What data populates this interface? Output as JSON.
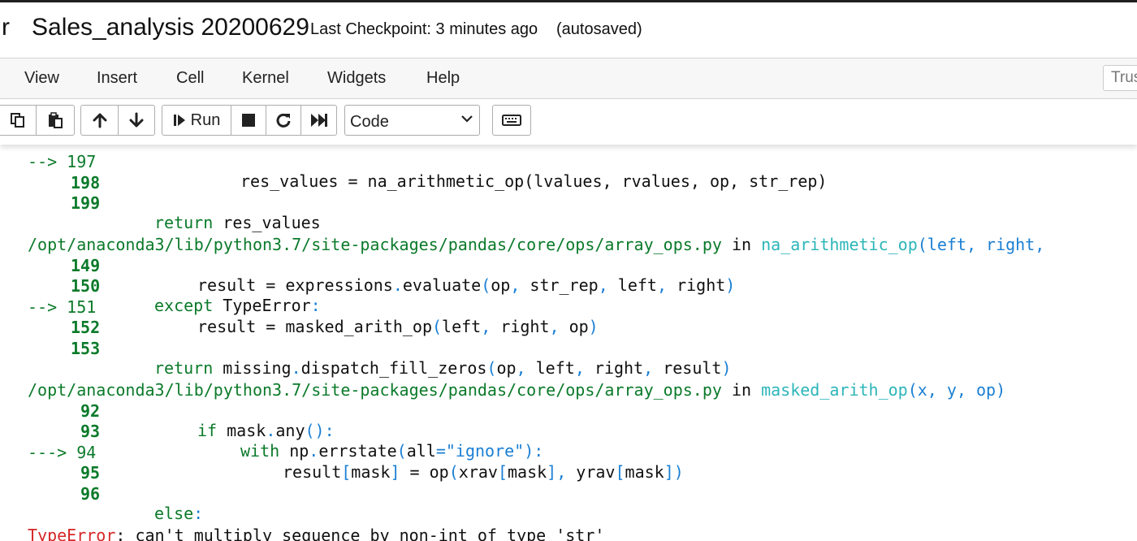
{
  "header": {
    "logo_fragment": "r",
    "notebook_title": "Sales_analysis 20200629",
    "checkpoint": "Last Checkpoint: 3 minutes ago",
    "autosaved": "(autosaved)"
  },
  "menu": {
    "items": [
      "View",
      "Insert",
      "Cell",
      "Kernel",
      "Widgets",
      "Help"
    ],
    "trusted": "Trus"
  },
  "toolbar": {
    "run_label": "Run",
    "cell_type": "Code"
  },
  "traceback": {
    "partial_line": {
      "arrow": "--> 197",
      "code": "res_values = na_arithmetic_op(lvalues, rvalues, op, str_rep)"
    },
    "frame1": [
      {
        "num": "198",
        "code": ""
      },
      {
        "num": "199",
        "kw": "return",
        "code": " res_values"
      }
    ],
    "frame2": {
      "file": "/opt/anaconda3/lib/python3.7/site-packages/pandas/core/ops/array_ops.py",
      "in": " in ",
      "func": "na_arithmetic_op",
      "args": "(left, right,",
      "lines": [
        {
          "num": "149",
          "text": "result = expressions.evaluate(op, str_rep, left, right)"
        },
        {
          "num": "150",
          "text": "except TypeError:"
        },
        {
          "num": "151",
          "arrow": "--> ",
          "text": "result = masked_arith_op(left, right, op)"
        },
        {
          "num": "152",
          "text": ""
        },
        {
          "num": "153",
          "text": "return missing.dispatch_fill_zeros(op, left, right, result)"
        }
      ]
    },
    "frame3": {
      "file": "/opt/anaconda3/lib/python3.7/site-packages/pandas/core/ops/array_ops.py",
      "in": " in ",
      "func": "masked_arith_op",
      "args": "(x, y, op)",
      "lines": [
        {
          "num": "92",
          "text": "if mask.any():"
        },
        {
          "num": "93",
          "text": "with np.errstate(all=\"ignore\"):"
        },
        {
          "num": "94",
          "arrow": "---> ",
          "text": "result[mask] = op(xrav[mask], yrav[mask])"
        },
        {
          "num": "95",
          "text": ""
        },
        {
          "num": "96",
          "text": "else:"
        }
      ]
    },
    "error": {
      "type": "TypeError",
      "message": ": can't multiply sequence by non-int of type 'str'"
    }
  }
}
